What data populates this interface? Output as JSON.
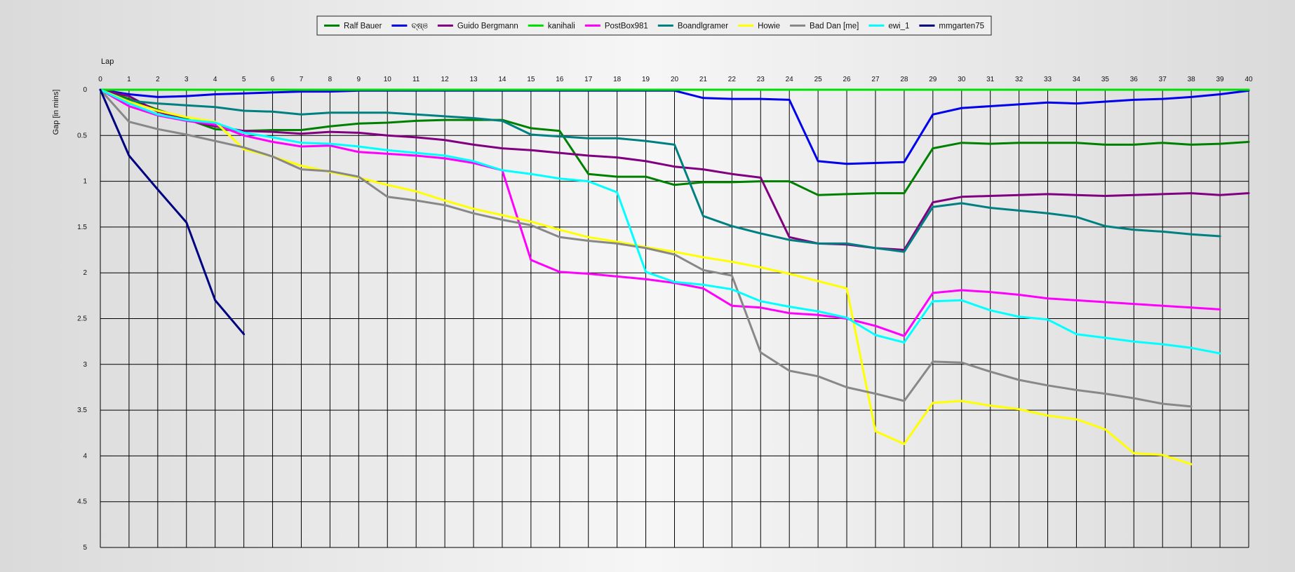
{
  "chart_data": {
    "type": "line",
    "xlabel": "Lap",
    "ylabel": "Gap [in mins]",
    "xlim": [
      0,
      40
    ],
    "ylim": [
      0,
      5
    ],
    "y_inverted": true,
    "grid": true,
    "legend": "top-center",
    "x_ticks": [
      "0",
      "1",
      "2",
      "3",
      "4",
      "5",
      "6",
      "7",
      "8",
      "9",
      "10",
      "11",
      "12",
      "13",
      "14",
      "15",
      "16",
      "17",
      "18",
      "19",
      "20",
      "21",
      "22",
      "23",
      "24",
      "25",
      "26",
      "27",
      "28",
      "29",
      "30",
      "31",
      "32",
      "33",
      "34",
      "35",
      "36",
      "37",
      "38",
      "39",
      "40"
    ],
    "y_ticks": [
      "0",
      "0.5",
      "1",
      "1.5",
      "2",
      "2.5",
      "3",
      "3.5",
      "4",
      "4.5",
      "5"
    ],
    "series": [
      {
        "name": "Ralf Bauer",
        "color": "#008000",
        "values": [
          0,
          0.1,
          0.22,
          0.32,
          0.43,
          0.45,
          0.44,
          0.44,
          0.4,
          0.37,
          0.36,
          0.34,
          0.33,
          0.33,
          0.33,
          0.42,
          0.45,
          0.92,
          0.95,
          0.95,
          1.04,
          1.01,
          1.01,
          1.0,
          1.0,
          1.15,
          1.14,
          1.13,
          1.13,
          0.64,
          0.58,
          0.59,
          0.58,
          0.58,
          0.58,
          0.6,
          0.6,
          0.58,
          0.6,
          0.59,
          0.57
        ]
      },
      {
        "name": "ବ୍ଷ୍ଞ",
        "color": "#0000ee",
        "values": [
          0,
          0.05,
          0.08,
          0.07,
          0.05,
          0.04,
          0.03,
          0.02,
          0.02,
          0.01,
          0.01,
          0.01,
          0.01,
          0.01,
          0.01,
          0.01,
          0.01,
          0.01,
          0.01,
          0.01,
          0.01,
          0.09,
          0.1,
          0.1,
          0.11,
          0.78,
          0.81,
          0.8,
          0.79,
          0.27,
          0.2,
          0.18,
          0.16,
          0.14,
          0.15,
          0.13,
          0.11,
          0.1,
          0.08,
          0.05,
          0.01
        ]
      },
      {
        "name": "Guido Bergmann",
        "color": "#800080",
        "values": [
          0,
          0.07,
          0.24,
          0.33,
          0.4,
          0.45,
          0.46,
          0.48,
          0.46,
          0.47,
          0.5,
          0.52,
          0.55,
          0.6,
          0.64,
          0.66,
          0.69,
          0.72,
          0.74,
          0.78,
          0.84,
          0.87,
          0.92,
          0.96,
          1.61,
          1.68,
          1.69,
          1.73,
          1.75,
          1.23,
          1.17,
          1.16,
          1.15,
          1.14,
          1.15,
          1.16,
          1.15,
          1.14,
          1.13,
          1.15,
          1.13
        ]
      },
      {
        "name": "kanihali",
        "color": "#00e000",
        "values": [
          0,
          0,
          0,
          0,
          0,
          0,
          0,
          0,
          0,
          0,
          0,
          0,
          0,
          0,
          0,
          0,
          0,
          0,
          0,
          0,
          0,
          0,
          0,
          0,
          0,
          0,
          0,
          0,
          0,
          0,
          0,
          0,
          0,
          0,
          0,
          0,
          0,
          0,
          0,
          0,
          0
        ]
      },
      {
        "name": "PostBox981",
        "color": "#ff00ff",
        "values": [
          0,
          0.18,
          0.28,
          0.34,
          0.38,
          0.5,
          0.57,
          0.62,
          0.61,
          0.68,
          0.7,
          0.72,
          0.75,
          0.8,
          0.88,
          1.86,
          1.99,
          2.01,
          2.04,
          2.07,
          2.11,
          2.17,
          2.36,
          2.38,
          2.44,
          2.46,
          2.5,
          2.58,
          2.69,
          2.22,
          2.19,
          2.21,
          2.24,
          2.28,
          2.3,
          2.32,
          2.34,
          2.36,
          2.38,
          2.4
        ]
      },
      {
        "name": "Boandlgramer",
        "color": "#008080",
        "values": [
          0,
          0.12,
          0.15,
          0.17,
          0.19,
          0.23,
          0.24,
          0.27,
          0.25,
          0.25,
          0.25,
          0.27,
          0.29,
          0.31,
          0.34,
          0.49,
          0.51,
          0.53,
          0.53,
          0.56,
          0.6,
          1.38,
          1.49,
          1.57,
          1.64,
          1.68,
          1.68,
          1.73,
          1.77,
          1.28,
          1.24,
          1.29,
          1.32,
          1.35,
          1.39,
          1.49,
          1.53,
          1.55,
          1.58,
          1.6
        ]
      },
      {
        "name": "Howie",
        "color": "#ffff00",
        "values": [
          0,
          0.13,
          0.23,
          0.3,
          0.35,
          0.65,
          0.73,
          0.83,
          0.9,
          0.96,
          1.04,
          1.11,
          1.21,
          1.3,
          1.37,
          1.44,
          1.53,
          1.61,
          1.66,
          1.72,
          1.77,
          1.83,
          1.88,
          1.94,
          2.01,
          2.09,
          2.17,
          3.73,
          3.87,
          3.42,
          3.4,
          3.45,
          3.49,
          3.56,
          3.6,
          3.71,
          3.97,
          3.99,
          4.09
        ]
      },
      {
        "name": "Bad Dan [me]",
        "color": "#888888",
        "values": [
          0,
          0.35,
          0.43,
          0.49,
          0.56,
          0.63,
          0.73,
          0.87,
          0.89,
          0.95,
          1.17,
          1.21,
          1.26,
          1.35,
          1.42,
          1.48,
          1.61,
          1.65,
          1.68,
          1.73,
          1.8,
          1.97,
          2.03,
          2.87,
          3.07,
          3.13,
          3.25,
          3.32,
          3.4,
          2.97,
          2.98,
          3.08,
          3.17,
          3.23,
          3.28,
          3.32,
          3.37,
          3.43,
          3.46
        ]
      },
      {
        "name": "ewi_1",
        "color": "#00ffff",
        "values": [
          0,
          0.15,
          0.27,
          0.33,
          0.36,
          0.47,
          0.52,
          0.58,
          0.59,
          0.62,
          0.66,
          0.69,
          0.72,
          0.78,
          0.88,
          0.92,
          0.97,
          1.0,
          1.12,
          1.99,
          2.1,
          2.13,
          2.18,
          2.31,
          2.37,
          2.42,
          2.49,
          2.68,
          2.76,
          2.31,
          2.3,
          2.41,
          2.48,
          2.51,
          2.67,
          2.71,
          2.75,
          2.78,
          2.82,
          2.88
        ]
      },
      {
        "name": "mmgarten75",
        "color": "#000080",
        "values": [
          0,
          0.72,
          1.09,
          1.45,
          2.3,
          2.67
        ]
      }
    ]
  }
}
